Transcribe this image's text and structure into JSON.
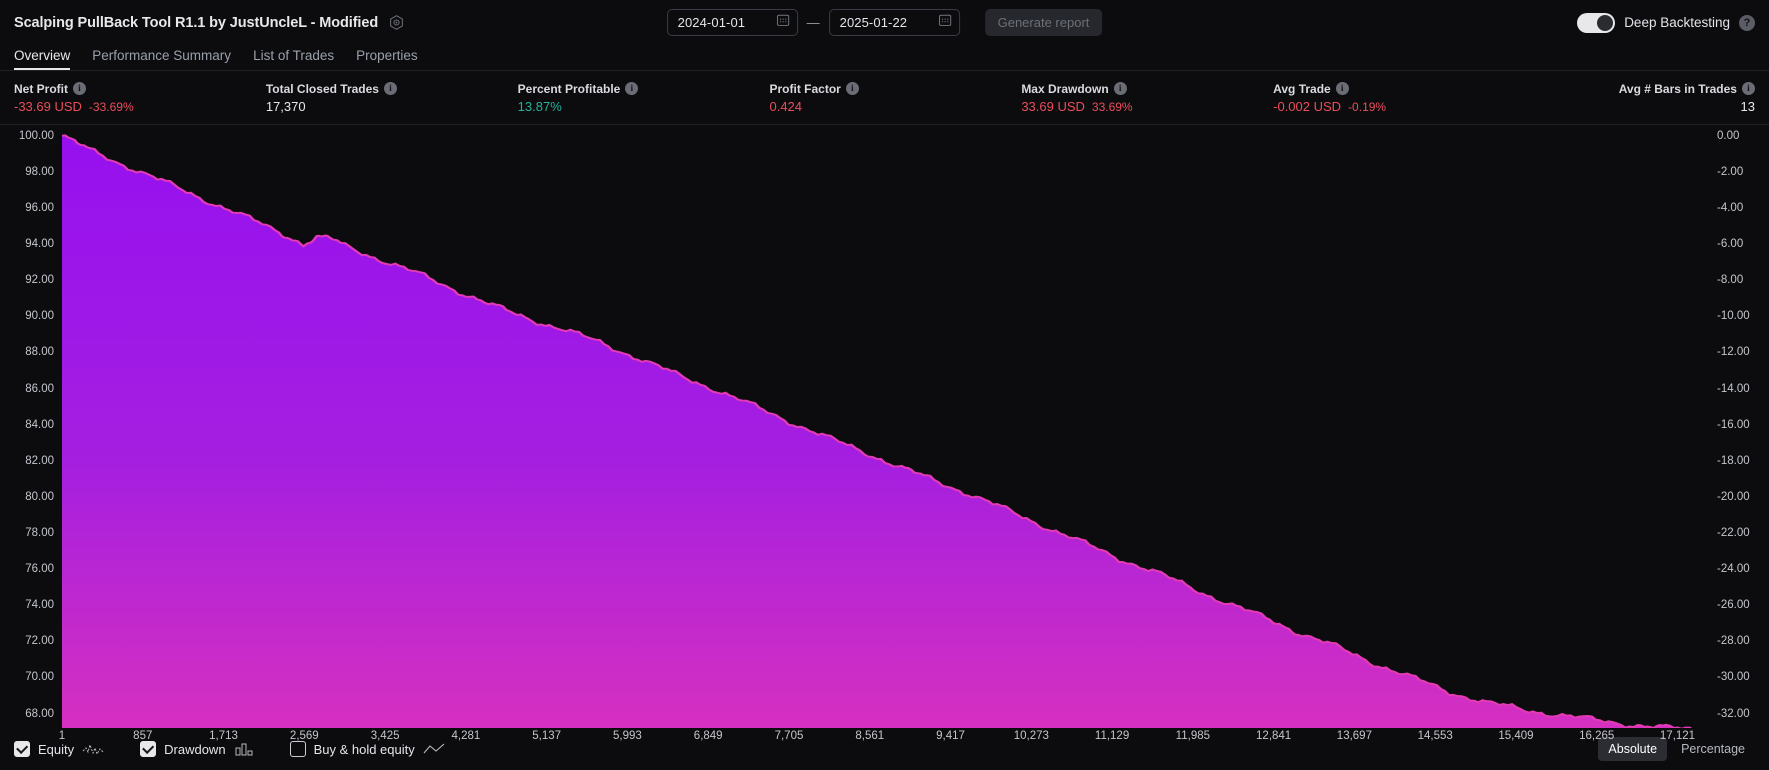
{
  "header": {
    "strategy_title": "Scalping PullBack Tool R1.1 by JustUncleL - Modified",
    "settings_icon": "gear-icon",
    "date_from": "2024-01-01",
    "date_to": "2025-01-22",
    "date_separator": "—",
    "calendar_icon": "calendar-icon",
    "generate_report_label": "Generate report",
    "deep_backtesting_label": "Deep Backtesting",
    "deep_backtesting_enabled": true,
    "help_icon_label": "?"
  },
  "tabs": [
    {
      "label": "Overview",
      "active": true
    },
    {
      "label": "Performance Summary",
      "active": false
    },
    {
      "label": "List of Trades",
      "active": false
    },
    {
      "label": "Properties",
      "active": false
    }
  ],
  "metrics": [
    {
      "label": "Net Profit",
      "primary": "-33.69 USD",
      "secondary": "-33.69%",
      "color": "red",
      "align": "left"
    },
    {
      "label": "Total Closed Trades",
      "primary": "17,370",
      "secondary": "",
      "color": "white",
      "align": "left"
    },
    {
      "label": "Percent Profitable",
      "primary": "13.87%",
      "secondary": "",
      "color": "green",
      "align": "left"
    },
    {
      "label": "Profit Factor",
      "primary": "0.424",
      "secondary": "",
      "color": "red",
      "align": "left"
    },
    {
      "label": "Max Drawdown",
      "primary": "33.69 USD",
      "secondary": "33.69%",
      "color": "red",
      "align": "left"
    },
    {
      "label": "Avg Trade",
      "primary": "-0.002 USD",
      "secondary": "-0.19%",
      "color": "red",
      "align": "left"
    },
    {
      "label": "Avg # Bars in Trades",
      "primary": "13",
      "secondary": "",
      "color": "white",
      "align": "right"
    }
  ],
  "chart_data": {
    "type": "area",
    "title": "",
    "xlabel": "",
    "ylabel": "",
    "left_axis": {
      "name": "Equity",
      "ticks": [
        "100.00",
        "98.00",
        "96.00",
        "94.00",
        "92.00",
        "90.00",
        "88.00",
        "86.00",
        "84.00",
        "82.00",
        "80.00",
        "78.00",
        "76.00",
        "74.00",
        "72.00",
        "70.00",
        "68.00"
      ],
      "values": [
        100,
        98,
        96,
        94,
        92,
        90,
        88,
        86,
        84,
        82,
        80,
        78,
        76,
        74,
        72,
        70,
        68
      ],
      "ylim": [
        67.2,
        100.6
      ]
    },
    "right_axis": {
      "name": "Drawdown",
      "ticks": [
        "0.00",
        "-2.00",
        "-4.00",
        "-6.00",
        "-8.00",
        "-10.00",
        "-12.00",
        "-14.00",
        "-16.00",
        "-18.00",
        "-20.00",
        "-22.00",
        "-24.00",
        "-26.00",
        "-28.00",
        "-30.00",
        "-32.00"
      ],
      "values": [
        0,
        -2,
        -4,
        -6,
        -8,
        -10,
        -12,
        -14,
        -16,
        -18,
        -20,
        -22,
        -24,
        -26,
        -28,
        -30,
        -32
      ],
      "ylim": [
        -32.8,
        0.6
      ]
    },
    "x_ticks": [
      "1",
      "857",
      "1,713",
      "2,569",
      "3,425",
      "4,281",
      "5,137",
      "5,993",
      "6,849",
      "7,705",
      "8,561",
      "9,417",
      "10,273",
      "11,129",
      "11,985",
      "12,841",
      "13,697",
      "14,553",
      "15,409",
      "16,265",
      "17,121"
    ],
    "x_values": [
      1,
      857,
      1713,
      2569,
      3425,
      4281,
      5137,
      5993,
      6849,
      7705,
      8561,
      9417,
      10273,
      11129,
      11985,
      12841,
      13697,
      14553,
      15409,
      16265,
      17121
    ],
    "xlim": [
      1,
      17370
    ],
    "grid": false,
    "legend_position": "bottom",
    "series": [
      {
        "name": "Equity",
        "type": "area",
        "fill_top_color": "#9610f0",
        "fill_bottom_color": "#d630c0",
        "line_color": "#e040b8",
        "points": [
          [
            1,
            100.0
          ],
          [
            300,
            99.2
          ],
          [
            700,
            98.3
          ],
          [
            1100,
            97.4
          ],
          [
            1500,
            96.5
          ],
          [
            1900,
            95.6
          ],
          [
            2300,
            94.7
          ],
          [
            2560,
            94.0
          ],
          [
            2700,
            94.35
          ],
          [
            2850,
            94.3
          ],
          [
            3000,
            93.9
          ],
          [
            3400,
            93.1
          ],
          [
            3800,
            92.3
          ],
          [
            4200,
            91.4
          ],
          [
            4560,
            90.6
          ],
          [
            4900,
            89.95
          ],
          [
            5300,
            89.3
          ],
          [
            5700,
            88.55
          ],
          [
            6100,
            87.7
          ],
          [
            6500,
            86.8
          ],
          [
            6900,
            86.0
          ],
          [
            7300,
            85.1
          ],
          [
            7700,
            84.2
          ],
          [
            8100,
            83.3
          ],
          [
            8500,
            82.5
          ],
          [
            8900,
            81.6
          ],
          [
            9200,
            81.0
          ],
          [
            9600,
            80.2
          ],
          [
            10000,
            79.3
          ],
          [
            10400,
            78.4
          ],
          [
            10800,
            77.5
          ],
          [
            11200,
            76.6
          ],
          [
            11600,
            75.8
          ],
          [
            12000,
            74.9
          ],
          [
            12400,
            74.0
          ],
          [
            12800,
            73.2
          ],
          [
            13100,
            72.5
          ],
          [
            13500,
            71.7
          ],
          [
            13900,
            70.8
          ],
          [
            14300,
            70.0
          ],
          [
            14700,
            69.2
          ],
          [
            15100,
            68.6
          ],
          [
            15500,
            68.2
          ],
          [
            15900,
            67.9
          ],
          [
            16300,
            67.6
          ],
          [
            16700,
            67.35
          ],
          [
            17000,
            67.2
          ],
          [
            17370,
            67.1
          ]
        ]
      },
      {
        "name": "Drawdown",
        "type": "area",
        "visible": true
      },
      {
        "name": "Buy & hold equity",
        "type": "line",
        "visible": false
      }
    ]
  },
  "footer": {
    "legend": [
      {
        "label": "Equity",
        "checked": true,
        "glyph": "equity-sparkline-icon"
      },
      {
        "label": "Drawdown",
        "checked": true,
        "glyph": "drawdown-bars-icon"
      },
      {
        "label": "Buy & hold equity",
        "checked": false,
        "glyph": "line-chart-icon"
      }
    ],
    "scale_buttons": [
      {
        "label": "Absolute",
        "active": true
      },
      {
        "label": "Percentage",
        "active": false
      }
    ]
  }
}
